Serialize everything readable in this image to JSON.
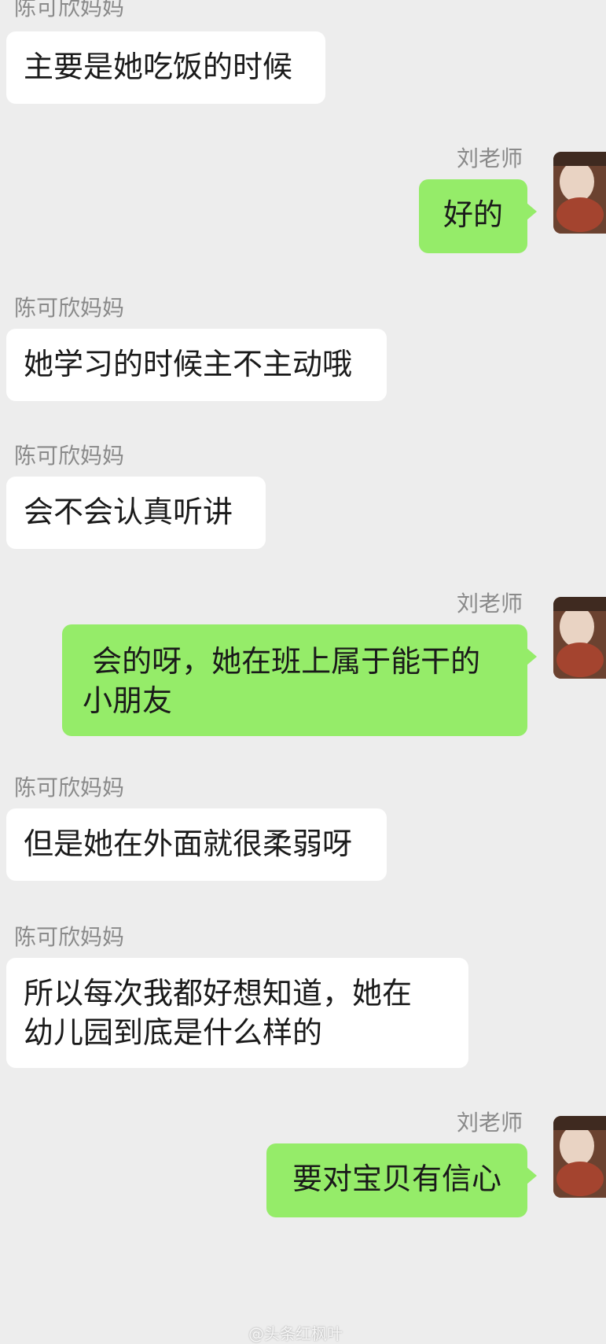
{
  "messages": [
    {
      "sender": "陈可欣妈妈",
      "text": "主要是她吃饭的时候"
    },
    {
      "sender": "刘老师",
      "text": "好的"
    },
    {
      "sender": "陈可欣妈妈",
      "text": "她学习的时候主不主动哦"
    },
    {
      "sender": "陈可欣妈妈",
      "text": "会不会认真听讲"
    },
    {
      "sender": "刘老师",
      "text": " 会的呀，她在班上属于能干的\n小朋友"
    },
    {
      "sender": "陈可欣妈妈",
      "text": "但是她在外面就很柔弱呀"
    },
    {
      "sender": "陈可欣妈妈",
      "text": "所以每次我都好想知道，她在\n幼儿园到底是什么样的"
    },
    {
      "sender": "刘老师",
      "text": "要对宝贝有信心"
    }
  ],
  "watermark": "@头条红枫叶",
  "colors": {
    "background": "#ededed",
    "self_bubble": "#95ec69",
    "other_bubble": "#ffffff",
    "sender_name": "#8a8a8a"
  }
}
